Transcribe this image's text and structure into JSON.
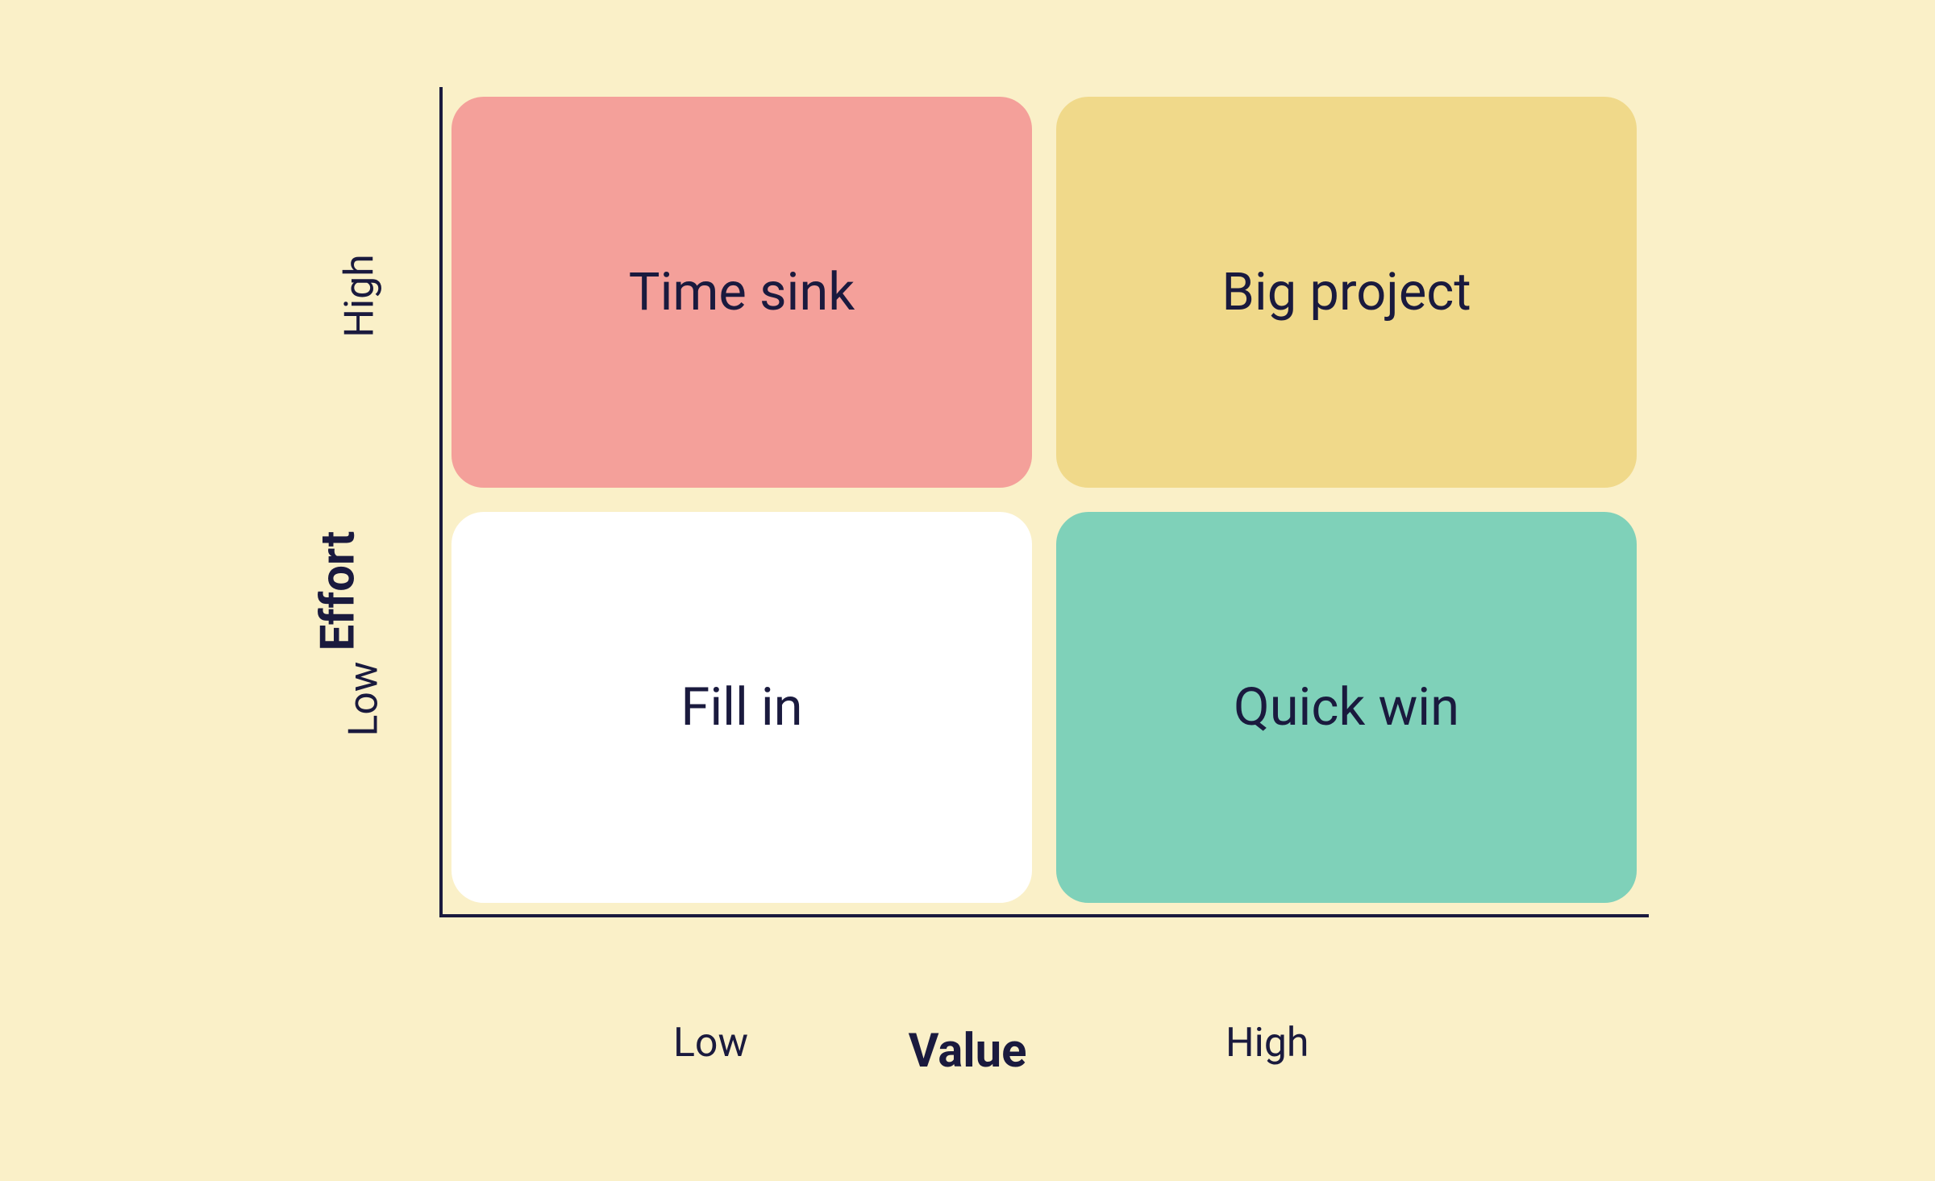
{
  "chart_data": {
    "type": "matrix-2x2",
    "y_axis": {
      "label": "Effort",
      "ticks": {
        "high": "High",
        "low": "Low"
      }
    },
    "x_axis": {
      "label": "Value",
      "ticks": {
        "low": "Low",
        "high": "High"
      }
    },
    "quadrants": {
      "high_effort_low_value": {
        "label": "Time sink",
        "color": "#f4a09a"
      },
      "high_effort_high_value": {
        "label": "Big project",
        "color": "#f0d98a"
      },
      "low_effort_low_value": {
        "label": "Fill in",
        "color": "#ffffff"
      },
      "low_effort_high_value": {
        "label": "Quick win",
        "color": "#7fd1b9"
      }
    }
  }
}
